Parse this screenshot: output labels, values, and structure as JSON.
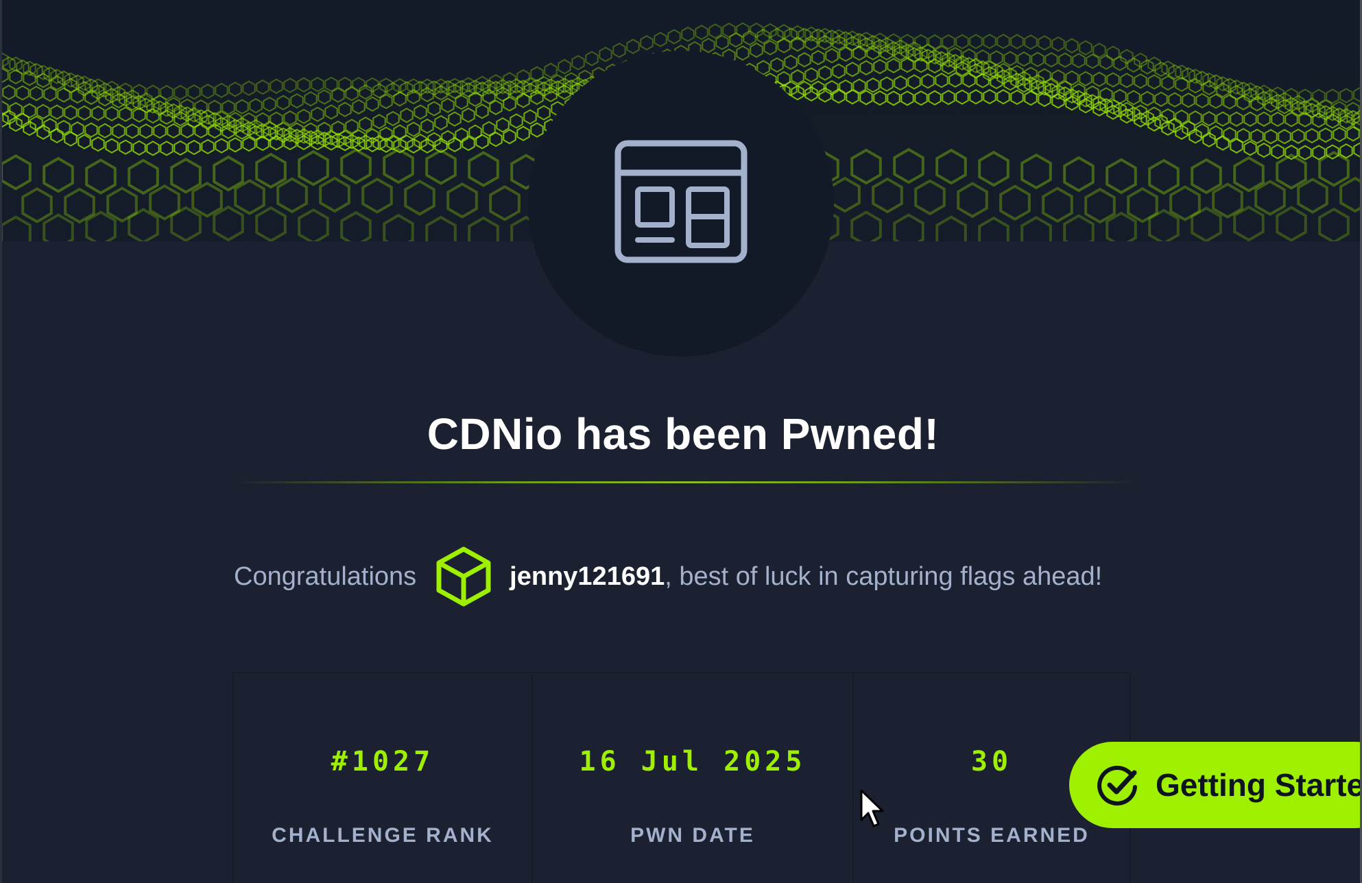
{
  "machine": {
    "title": "CDNio has been Pwned!",
    "icon": "browser-window-icon"
  },
  "congrats": {
    "prefix": "Congratulations",
    "username": "jenny121691",
    "suffix": ", best of luck in capturing flags ahead!",
    "avatar_icon": "cube-icon"
  },
  "stats": [
    {
      "value": "#1027",
      "label": "CHALLENGE RANK"
    },
    {
      "value": "16 Jul 2025",
      "label": "PWN DATE"
    },
    {
      "value": "30",
      "label": "POINTS EARNED"
    }
  ],
  "getting_started": {
    "label": "Getting Started",
    "icon": "check-circle-icon"
  },
  "colors": {
    "accent": "#9fef00",
    "background": "#1b2130",
    "text_muted": "#a4b1cd"
  }
}
